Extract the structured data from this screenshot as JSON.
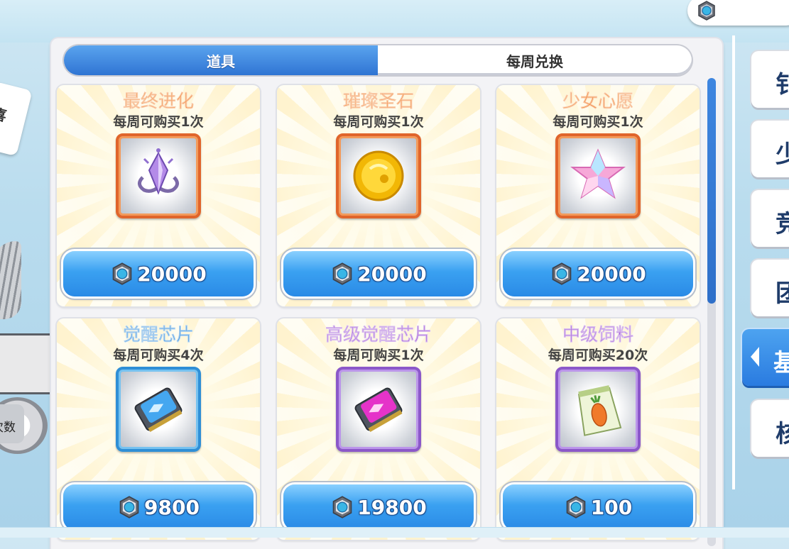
{
  "tabs": [
    {
      "label": "道具",
      "active": true
    },
    {
      "label": "每周兑换",
      "active": false
    }
  ],
  "items": [
    {
      "name": "最终进化",
      "name_color": "#f07a23",
      "limit": "每周可购买1次",
      "frame": "orange",
      "icon": "evolution-crystal-icon",
      "price": "20000"
    },
    {
      "name": "璀璨圣石",
      "name_color": "#f07a23",
      "limit": "每周可购买1次",
      "frame": "orange",
      "icon": "gold-holy-stone-icon",
      "price": "20000"
    },
    {
      "name": "少女心愿",
      "name_color": "#f07a23",
      "limit": "每周可购买1次",
      "frame": "orange",
      "icon": "star-crystal-icon",
      "price": "20000"
    },
    {
      "name": "觉醒芯片",
      "name_color": "#2f8ad8",
      "limit": "每周可购买4次",
      "frame": "blue",
      "icon": "blue-chip-icon",
      "price": "9800"
    },
    {
      "name": "高级觉醒芯片",
      "name_color": "#9a4fd1",
      "limit": "每周可购买1次",
      "frame": "purple",
      "icon": "purple-chip-icon",
      "price": "19800"
    },
    {
      "name": "中级饲料",
      "name_color": "#9a4fd1",
      "limit": "每周可购买20次",
      "frame": "purple",
      "icon": "feed-bag-icon",
      "price": "100"
    }
  ],
  "side_buttons": [
    {
      "label": "钅",
      "active": false
    },
    {
      "label": "少",
      "active": false
    },
    {
      "label": "竞",
      "active": false
    },
    {
      "label": "团",
      "active": false
    },
    {
      "label": "基",
      "active": true
    },
    {
      "label": "核",
      "active": false
    }
  ],
  "background": {
    "card_text": "喜",
    "machine_badge": "次数"
  },
  "currency_icon": "gear-coin-icon"
}
